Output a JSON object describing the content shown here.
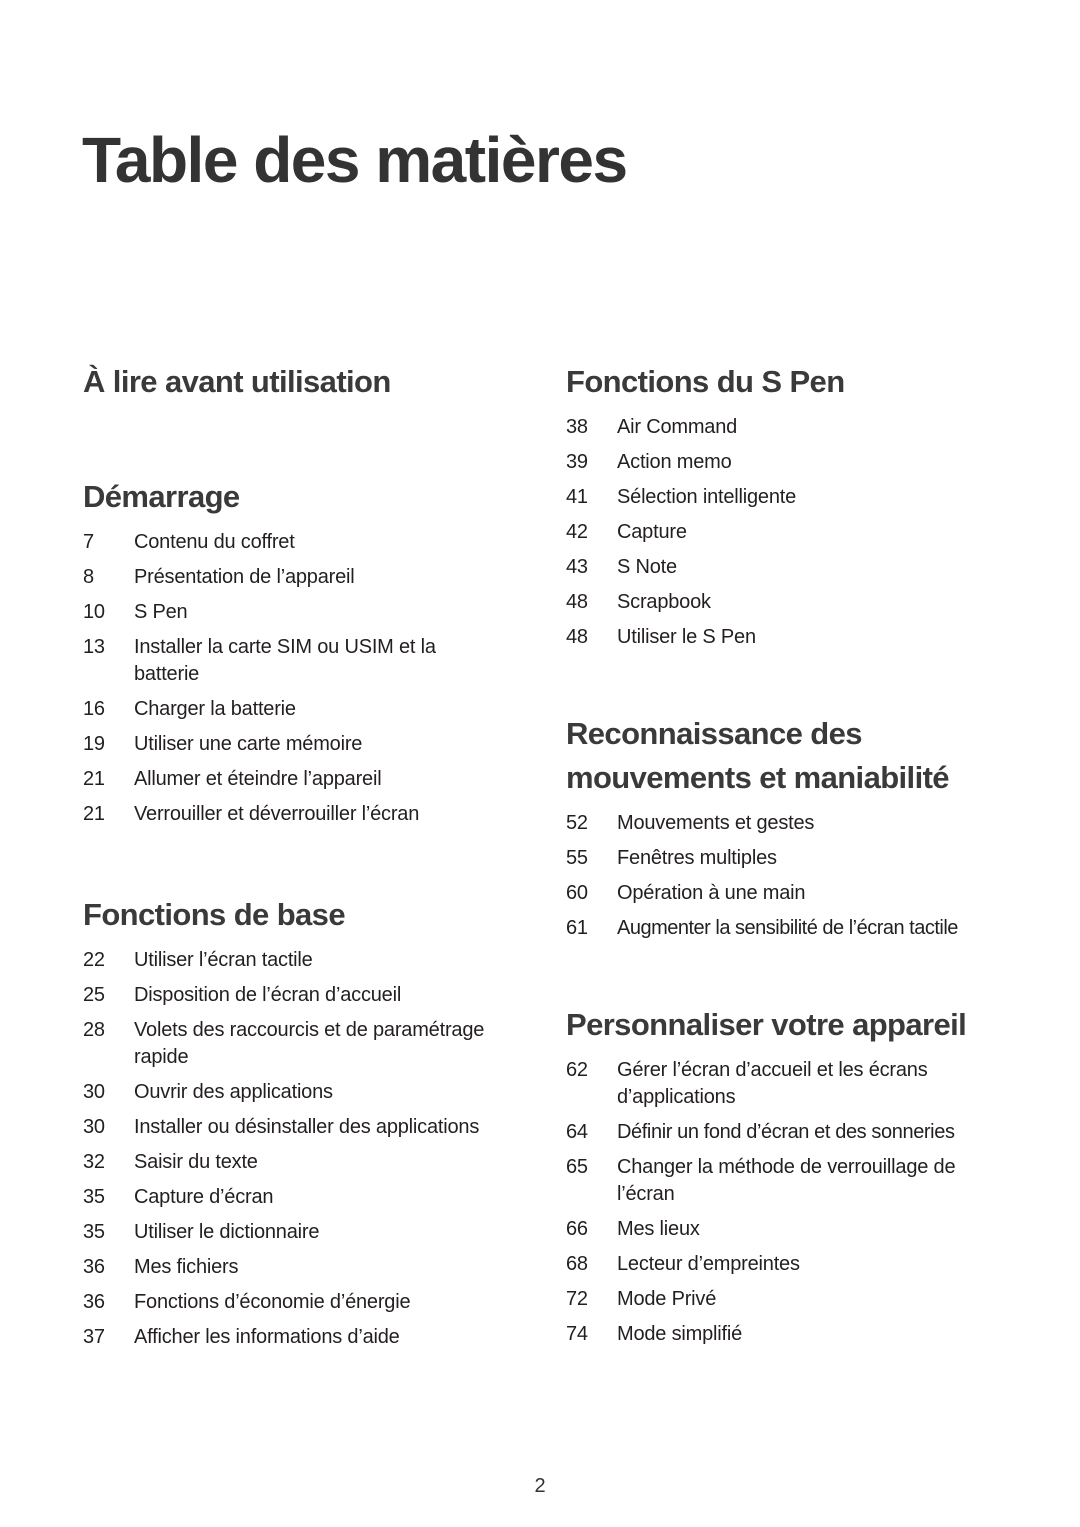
{
  "page_title": "Table des matières",
  "page_number": "2",
  "left_column": [
    {
      "title": "À lire avant utilisation",
      "items": []
    },
    {
      "title": "Démarrage",
      "items": [
        {
          "page": "7",
          "label": "Contenu du coffret"
        },
        {
          "page": "8",
          "label": "Présentation de l’appareil"
        },
        {
          "page": "10",
          "label": "S Pen"
        },
        {
          "page": "13",
          "label": "Installer la carte SIM ou USIM et la batterie"
        },
        {
          "page": "16",
          "label": "Charger la batterie"
        },
        {
          "page": "19",
          "label": "Utiliser une carte mémoire"
        },
        {
          "page": "21",
          "label": "Allumer et éteindre l’appareil"
        },
        {
          "page": "21",
          "label": "Verrouiller et déverrouiller l’écran"
        }
      ]
    },
    {
      "title": "Fonctions de base",
      "items": [
        {
          "page": "22",
          "label": "Utiliser l’écran tactile"
        },
        {
          "page": "25",
          "label": "Disposition de l’écran d’accueil"
        },
        {
          "page": "28",
          "label": "Volets des raccourcis et de paramétrage rapide"
        },
        {
          "page": "30",
          "label": "Ouvrir des applications"
        },
        {
          "page": "30",
          "label": "Installer ou désinstaller des applications"
        },
        {
          "page": "32",
          "label": "Saisir du texte"
        },
        {
          "page": "35",
          "label": "Capture d’écran"
        },
        {
          "page": "35",
          "label": "Utiliser le dictionnaire"
        },
        {
          "page": "36",
          "label": "Mes fichiers"
        },
        {
          "page": "36",
          "label": "Fonctions d’économie d’énergie"
        },
        {
          "page": "37",
          "label": "Afficher les informations d’aide"
        }
      ]
    }
  ],
  "right_column": [
    {
      "title": "Fonctions du S Pen",
      "items": [
        {
          "page": "38",
          "label": "Air Command"
        },
        {
          "page": "39",
          "label": "Action memo"
        },
        {
          "page": "41",
          "label": "Sélection intelligente"
        },
        {
          "page": "42",
          "label": "Capture"
        },
        {
          "page": "43",
          "label": "S Note"
        },
        {
          "page": "48",
          "label": "Scrapbook"
        },
        {
          "page": "48",
          "label": "Utiliser le S Pen"
        }
      ]
    },
    {
      "title": "Reconnaissance des mouvements et maniabilité",
      "items": [
        {
          "page": "52",
          "label": "Mouvements et gestes"
        },
        {
          "page": "55",
          "label": "Fenêtres multiples"
        },
        {
          "page": "60",
          "label": "Opération à une main"
        },
        {
          "page": "61",
          "label": "Augmenter la sensibilité de l’écran tactile"
        }
      ]
    },
    {
      "title": "Personnaliser votre appareil",
      "items": [
        {
          "page": "62",
          "label": "Gérer l’écran d’accueil et les écrans d’applications"
        },
        {
          "page": "64",
          "label": "Définir un fond d’écran et des sonneries"
        },
        {
          "page": "65",
          "label": "Changer la méthode de verrouillage de l’écran"
        },
        {
          "page": "66",
          "label": "Mes lieux"
        },
        {
          "page": "68",
          "label": "Lecteur d’empreintes"
        },
        {
          "page": "72",
          "label": "Mode Privé"
        },
        {
          "page": "74",
          "label": "Mode simplifié"
        }
      ]
    }
  ]
}
